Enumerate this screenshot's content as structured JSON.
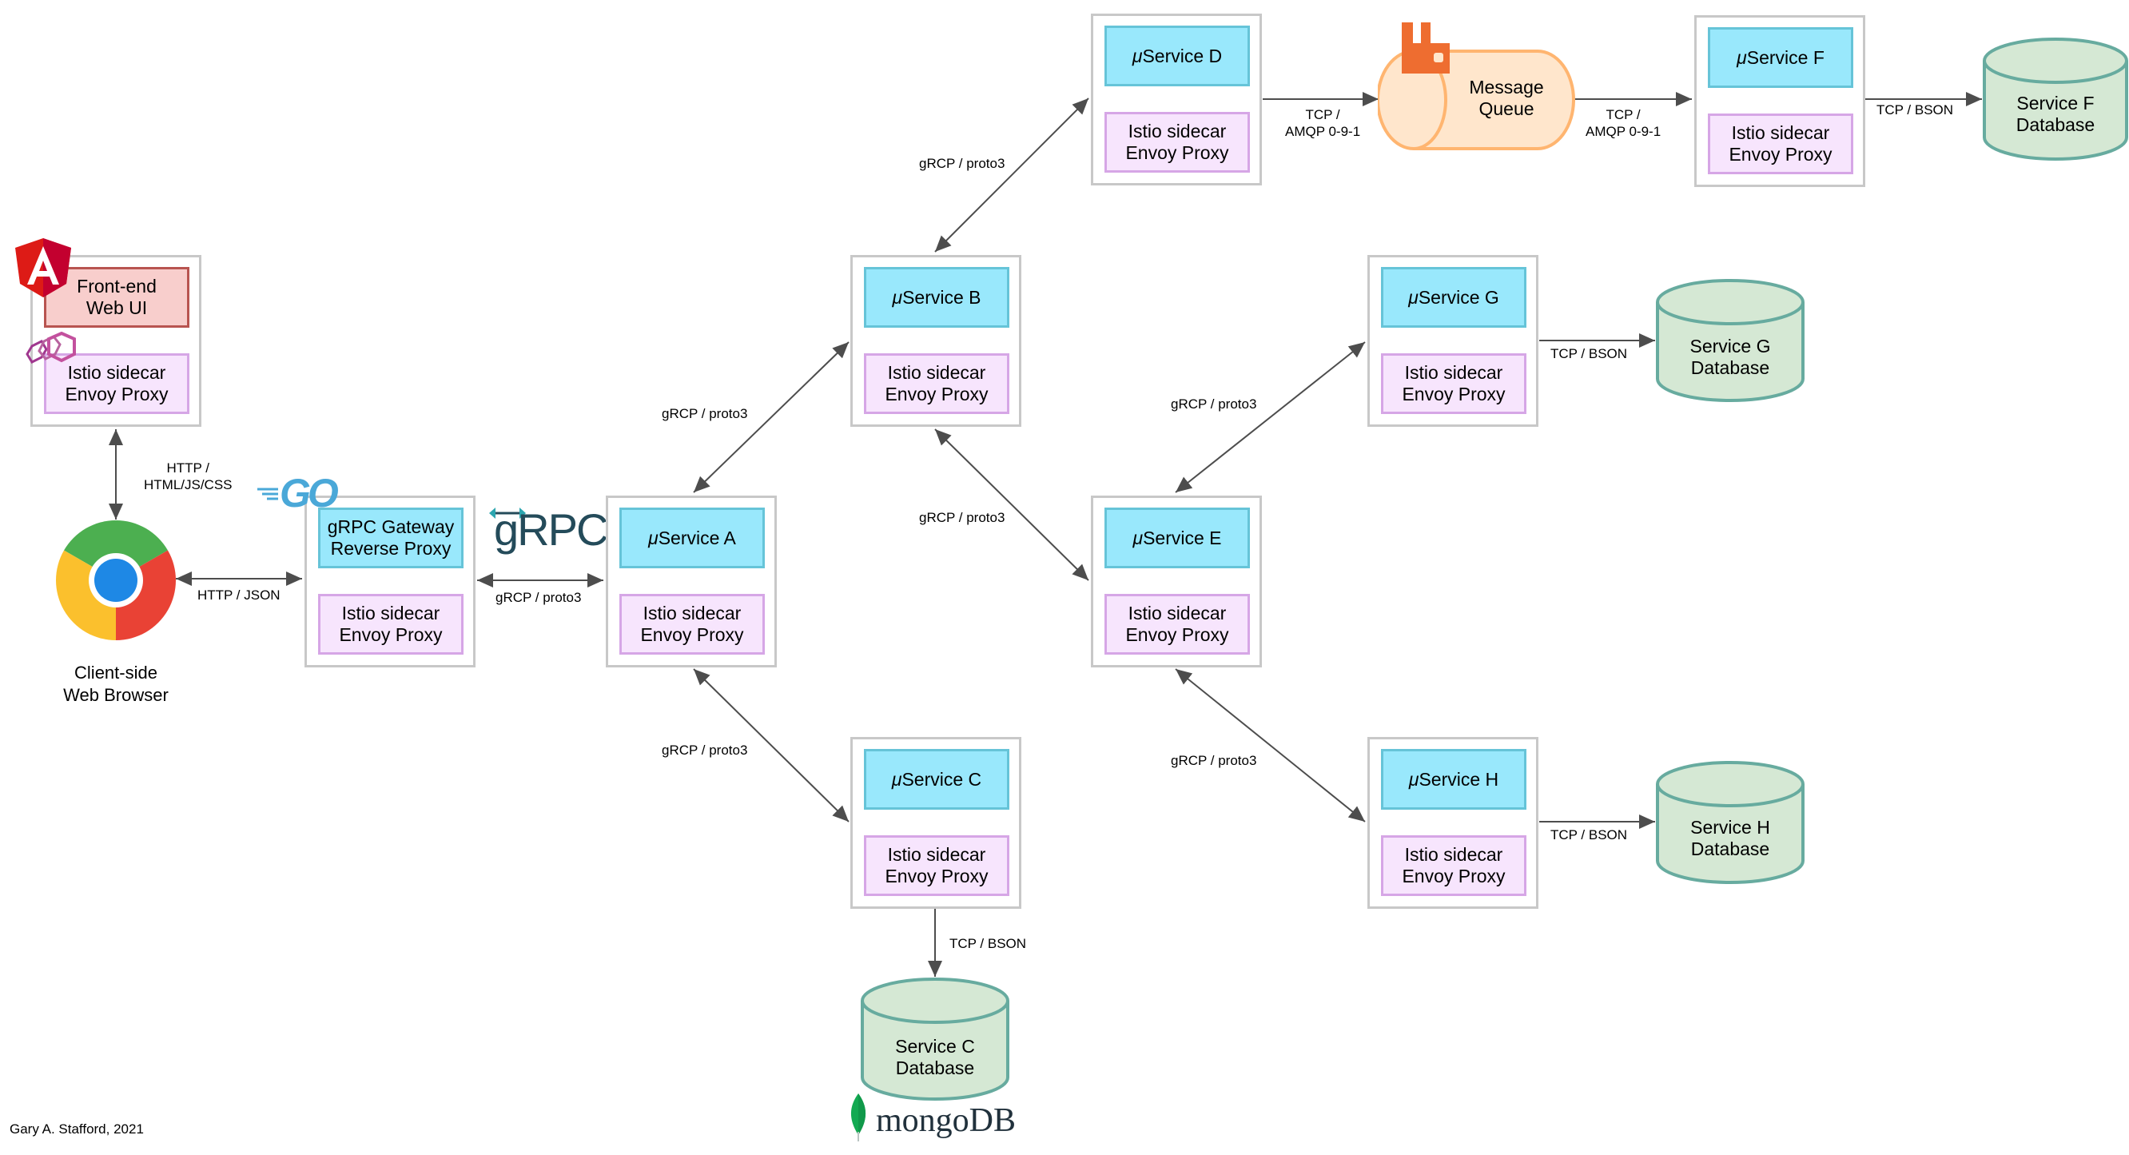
{
  "diagram": {
    "credit": "Gary A. Stafford, 2021",
    "frontend": {
      "title_line1": "Front-end",
      "title_line2": "Web UI",
      "sidecar_line1": "Istio sidecar",
      "sidecar_line2": "Envoy Proxy"
    },
    "browser": {
      "line1": "Client-side",
      "line2": "Web Browser"
    },
    "gateway": {
      "title_line1": "gRPC Gateway",
      "title_line2": "Reverse Proxy",
      "sidecar_line1": "Istio sidecar",
      "sidecar_line2": "Envoy Proxy"
    },
    "services": {
      "a": {
        "mu": "μ",
        "name": "Service A",
        "sidecar_line1": "Istio sidecar",
        "sidecar_line2": "Envoy Proxy"
      },
      "b": {
        "mu": "μ",
        "name": "Service B",
        "sidecar_line1": "Istio sidecar",
        "sidecar_line2": "Envoy Proxy"
      },
      "c": {
        "mu": "μ",
        "name": "Service C",
        "sidecar_line1": "Istio sidecar",
        "sidecar_line2": "Envoy Proxy"
      },
      "d": {
        "mu": "μ",
        "name": "Service D",
        "sidecar_line1": "Istio sidecar",
        "sidecar_line2": "Envoy Proxy"
      },
      "e": {
        "mu": "μ",
        "name": "Service E",
        "sidecar_line1": "Istio sidecar",
        "sidecar_line2": "Envoy Proxy"
      },
      "f": {
        "mu": "μ",
        "name": "Service F",
        "sidecar_line1": "Istio sidecar",
        "sidecar_line2": "Envoy Proxy"
      },
      "g": {
        "mu": "μ",
        "name": "Service G",
        "sidecar_line1": "Istio sidecar",
        "sidecar_line2": "Envoy Proxy"
      },
      "h": {
        "mu": "μ",
        "name": "Service H",
        "sidecar_line1": "Istio sidecar",
        "sidecar_line2": "Envoy Proxy"
      }
    },
    "databases": {
      "c": {
        "line1": "Service C",
        "line2": "Database"
      },
      "f": {
        "line1": "Service F",
        "line2": "Database"
      },
      "g": {
        "line1": "Service G",
        "line2": "Database"
      },
      "h": {
        "line1": "Service H",
        "line2": "Database"
      }
    },
    "queue": {
      "line1": "Message",
      "line2": "Queue"
    },
    "edges": {
      "fe_browser": {
        "line1": "HTTP /",
        "line2": "HTML/JS/CSS"
      },
      "browser_gateway": "HTTP / JSON",
      "gateway_a": "gRCP / proto3",
      "a_b": "gRCP / proto3",
      "a_c": "gRCP / proto3",
      "b_d": "gRCP / proto3",
      "b_e": "gRCP / proto3",
      "e_g": "gRCP / proto3",
      "e_h": "gRCP / proto3",
      "d_queue": {
        "line1": "TCP /",
        "line2": "AMQP 0-9-1"
      },
      "queue_f": {
        "line1": "TCP /",
        "line2": "AMQP 0-9-1"
      },
      "f_db": "TCP / BSON",
      "g_db": "TCP / BSON",
      "h_db": "TCP / BSON",
      "c_db": "TCP / BSON"
    },
    "logos": {
      "grpc": "gRPC",
      "go": "GO",
      "mongodb": "mongoDB",
      "angular": "A"
    },
    "colors": {
      "service": "#99e8fc",
      "sidecar": "#f7e5fd",
      "frontend": "#f8cecc",
      "database": "#d5e8d4",
      "database_stroke": "#67ab9f",
      "queue": "#ffe6cc",
      "queue_stroke": "#ffb570",
      "edge": "#4d4d4d"
    }
  }
}
